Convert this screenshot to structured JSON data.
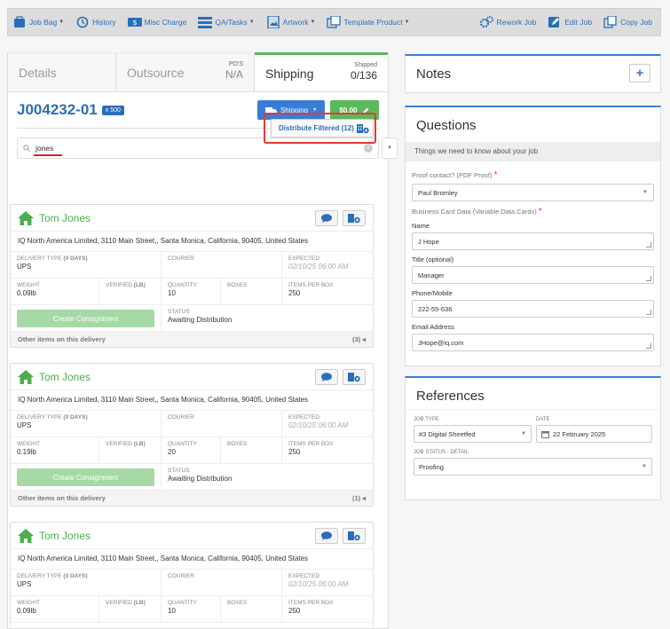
{
  "toolbar": {
    "items": [
      {
        "label": "Job Bag",
        "icon": "job-bag-icon",
        "caret": true
      },
      {
        "label": "History",
        "icon": "history-icon",
        "caret": false
      },
      {
        "label": "Misc Charge",
        "icon": "misc-charge-icon",
        "caret": false
      },
      {
        "label": "QA/Tasks",
        "icon": "tasks-icon",
        "caret": true
      },
      {
        "label": "Artwork",
        "icon": "artwork-icon",
        "caret": true
      },
      {
        "label": "Template Product",
        "icon": "template-icon",
        "caret": true
      }
    ],
    "right_items": [
      {
        "label": "Rework Job",
        "icon": "rework-icon"
      },
      {
        "label": "Edit Job",
        "icon": "edit-icon"
      },
      {
        "label": "Copy Job",
        "icon": "copy-icon"
      }
    ]
  },
  "tabs": {
    "details": "Details",
    "outsource": "Outsource",
    "pos_label": "PO'S",
    "pos_value": "N/A",
    "shipping": "Shipping",
    "shipped_label": "Shipped",
    "shipped_value": "0/136"
  },
  "job": {
    "id": "J004232-01",
    "qty_badge": "x 500",
    "shipping_button": "Shipping",
    "price_button": "$0.00"
  },
  "search": {
    "value": "jones"
  },
  "distribute_button": "Distribute Filtered (12)",
  "labels": {
    "delivery_type": "DELIVERY TYPE",
    "delivery_days": "(0 DAYS)",
    "courier": "COURIER",
    "expected": "EXPECTED",
    "weight": "WEIGHT",
    "verified": "VERIFIED",
    "verified_unit": "(LB)",
    "quantity": "QUANTITY",
    "boxes": "BOXES",
    "items_per_box": "ITEMS PER BOX",
    "status": "STATUS",
    "create_consignment": "Create Consignment",
    "other_items": "Other items on this delivery"
  },
  "deliveries": [
    {
      "name": "Tom Jones",
      "address": "IQ North America Limited, 3110 Main Street,, Santa Monica, California, 90405, United States",
      "delivery_type": "UPS",
      "courier": "",
      "expected": "02/10/25 06:00 AM",
      "weight": "0.09lb",
      "verified": "",
      "quantity": "10",
      "boxes": "",
      "items_per_box": "250",
      "status": "Awaiting Distribution",
      "other_count": "(3)"
    },
    {
      "name": "Tom Jones",
      "address": "IQ North America Limited, 3110 Main Street,, Santa Monica, California, 90405, United States",
      "delivery_type": "UPS",
      "courier": "",
      "expected": "02/10/25 06:00 AM",
      "weight": "0.19lb",
      "verified": "",
      "quantity": "20",
      "boxes": "",
      "items_per_box": "250",
      "status": "Awaiting Distribution",
      "other_count": "(1)"
    },
    {
      "name": "Tom Jones",
      "address": "IQ North America Limited, 3110 Main Street,, Santa Monica, California, 90405, United States",
      "delivery_type": "UPS",
      "courier": "",
      "expected": "02/10/25 06:00 AM",
      "weight": "0.09lb",
      "verified": "",
      "quantity": "10",
      "boxes": "",
      "items_per_box": "250"
    }
  ],
  "notes": {
    "title": "Notes",
    "add": "+"
  },
  "questions": {
    "title": "Questions",
    "subtitle": "Things we need to know about your job",
    "proof_label": "Proof contact? (PDF Proof)",
    "proof_value": "Paul Bromley",
    "bc_label": "Business Card Data (Variable Data Cards)",
    "fields": [
      {
        "label": "Name",
        "value": "J Hope"
      },
      {
        "label": "Title (optional)",
        "value": "Manager"
      },
      {
        "label": "Phone/Mobile",
        "value": "222-55-636"
      },
      {
        "label": "Email Address",
        "value": "JHope@iq.com"
      }
    ]
  },
  "references": {
    "title": "References",
    "job_type_label": "JOB TYPE",
    "job_type_value": "#3 Digital Sheetfed",
    "date_label": "DATE",
    "date_value": "22 February 2025",
    "status_label": "JOB STATUS - DETAIL",
    "status_value": "Proofing"
  },
  "colors": {
    "accent": "#2a6ebb",
    "green": "#5cb85c",
    "highlight": "#e53935"
  }
}
